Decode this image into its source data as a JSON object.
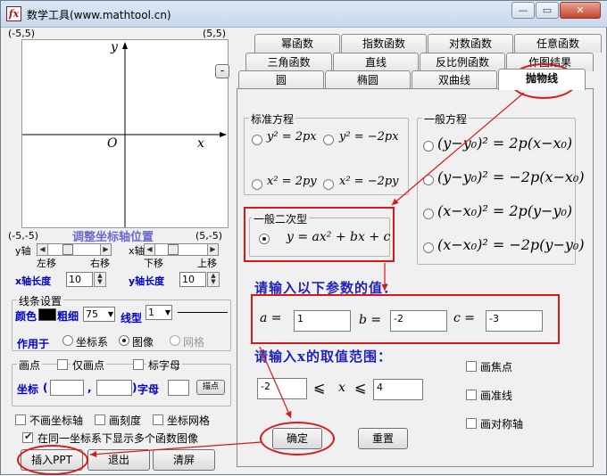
{
  "window": {
    "title": "数学工具(www.mathtool.cn)",
    "icon": "fx-app-icon",
    "min_glyph": "—",
    "max_glyph": "▭",
    "close_glyph": "✕",
    "collapse_label": "-"
  },
  "graph": {
    "corner_tl": "(-5,5)",
    "corner_tr": "(5,5)",
    "corner_bl": "(-5,-5)",
    "corner_br": "(5,-5)",
    "x_label": "x",
    "y_label": "y",
    "origin_label": "O",
    "axis_adjust_title": "调整坐标轴位置"
  },
  "axis_controls": {
    "y_axis": "y轴",
    "x_axis": "x轴",
    "left": "左移",
    "right": "右移",
    "down": "下移",
    "up": "上移",
    "x_len_label": "x轴长度",
    "x_len_value": "10",
    "y_len_label": "y轴长度",
    "y_len_value": "10"
  },
  "line_settings": {
    "title": "线条设置",
    "color_label": "颜色",
    "thickness_label": "粗细",
    "thickness_value": "75",
    "type_label": "线型",
    "type_value": "1",
    "apply_label": "作用于",
    "apply_options": [
      "坐标系",
      "图像",
      "网格"
    ],
    "apply_selected": 1
  },
  "point_group": {
    "title": "画点",
    "only_point_label": "仅画点",
    "label_label": "标字母",
    "coord_label": "坐标",
    "coord_open": "(",
    "coord_comma": ",",
    "coord_close": ")",
    "letter_label": "字母",
    "draw_point_btn": "描点"
  },
  "options": {
    "no_axis": "不画坐标轴",
    "draw_ticks": "画刻度",
    "axis_grid": "坐标网格",
    "multi_graph": "在同一坐标系下显示多个函数图像",
    "multi_graph_checked": true
  },
  "bottom_buttons": {
    "insert_ppt": "插入PPT",
    "exit": "退出",
    "clear": "清屏"
  },
  "tabs": {
    "row1": [
      "幂函数",
      "指数函数",
      "对数函数",
      "任意函数"
    ],
    "row2": [
      "三角函数",
      "直线",
      "反比例函数",
      "作图结果"
    ],
    "row3": [
      "圆",
      "椭圆",
      "双曲线",
      "抛物线"
    ],
    "selected": "抛物线"
  },
  "standard_eq": {
    "title": "标准方程",
    "items": [
      "y² = 2px",
      "y² = −2px",
      "x² = 2py",
      "x² = −2py"
    ]
  },
  "general_eq": {
    "title": "一般方程",
    "items": [
      "(y−y₀)² = 2p(x−x₀)",
      "(y−y₀)² = −2p(x−x₀)",
      "(x−x₀)² = 2p(y−y₀)",
      "(x−x₀)² = −2p(y−y₀)"
    ]
  },
  "quadratic": {
    "title": "一般二次型",
    "formula": "y = ax² + bx + c"
  },
  "params": {
    "heading": "请输入以下参数的值：",
    "a_label": "a =",
    "a_value": "1",
    "b_label": "b =",
    "b_value": "-2",
    "c_label": "c =",
    "c_value": "-3"
  },
  "range": {
    "heading": "请输入x的取值范围：",
    "min": "-2",
    "op1": "⩽",
    "var": "x",
    "op2": "⩽",
    "max": "4"
  },
  "draw_options": {
    "focus": "画焦点",
    "directrix": "画准线",
    "axis": "画对称轴"
  },
  "actions": {
    "confirm": "确定",
    "reset": "重置"
  },
  "annotation_color": "#d81818"
}
